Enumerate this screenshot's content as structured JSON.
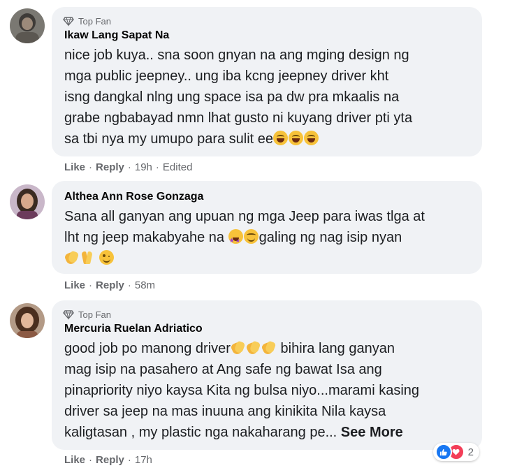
{
  "comments": [
    {
      "top_fan": "Top Fan",
      "author": "Ikaw Lang Sapat Na",
      "lines": [
        "nice job kuya.. sna soon gnyan na ang mging design ng",
        "mga public jeepney.. ung iba kcng jeepney driver kht",
        "isng dangkal nlng ung space isa pa dw pra mkaalis na",
        "grabe ngbabayad nmn lhat gusto ni kuyang driver pti yta",
        "sa tbi nya my umupo para sulit ee"
      ],
      "emojis": [
        "laughing-crying",
        "laughing-crying",
        "laughing-crying"
      ],
      "actions": {
        "like": "Like",
        "reply": "Reply",
        "time": "19h",
        "edited": "Edited"
      }
    },
    {
      "author": "Althea Ann Rose Gonzaga",
      "lines": [
        "Sana all ganyan ang upuan ng mga Jeep para iwas tlga at",
        "lht ng jeep makabyahe na",
        "galing ng nag isip nyan"
      ],
      "emojis": [
        "star-struck",
        "smiling",
        "clapping-hands",
        "folded-hands",
        "winking"
      ],
      "actions": {
        "like": "Like",
        "reply": "Reply",
        "time": "58m"
      }
    },
    {
      "top_fan": "Top Fan",
      "author": "Mercuria Ruelan Adriatico",
      "lines": [
        "good job po manong driver",
        "bihira lang ganyan",
        "mag isip na pasahero at Ang safe ng bawat Isa ang",
        "pinapriority niyo kaysa Kita ng bulsa niyo...marami kasing",
        "driver sa jeep na mas inuuna ang kinikita Nila kaysa",
        "kaligtasan , my plastic nga nakaharang pe..."
      ],
      "see_more": "See More",
      "emojis": [
        "clapping-hands",
        "clapping-hands",
        "clapping-hands"
      ],
      "actions": {
        "like": "Like",
        "reply": "Reply",
        "time": "17h"
      },
      "reactions": {
        "icons": [
          "like-icon",
          "love-icon"
        ],
        "count": "2"
      }
    }
  ],
  "colors": {
    "bubble": "#f0f2f5",
    "meta_text": "#65676b",
    "like_blue": "#1877f2",
    "love_red": "#f33e58"
  }
}
